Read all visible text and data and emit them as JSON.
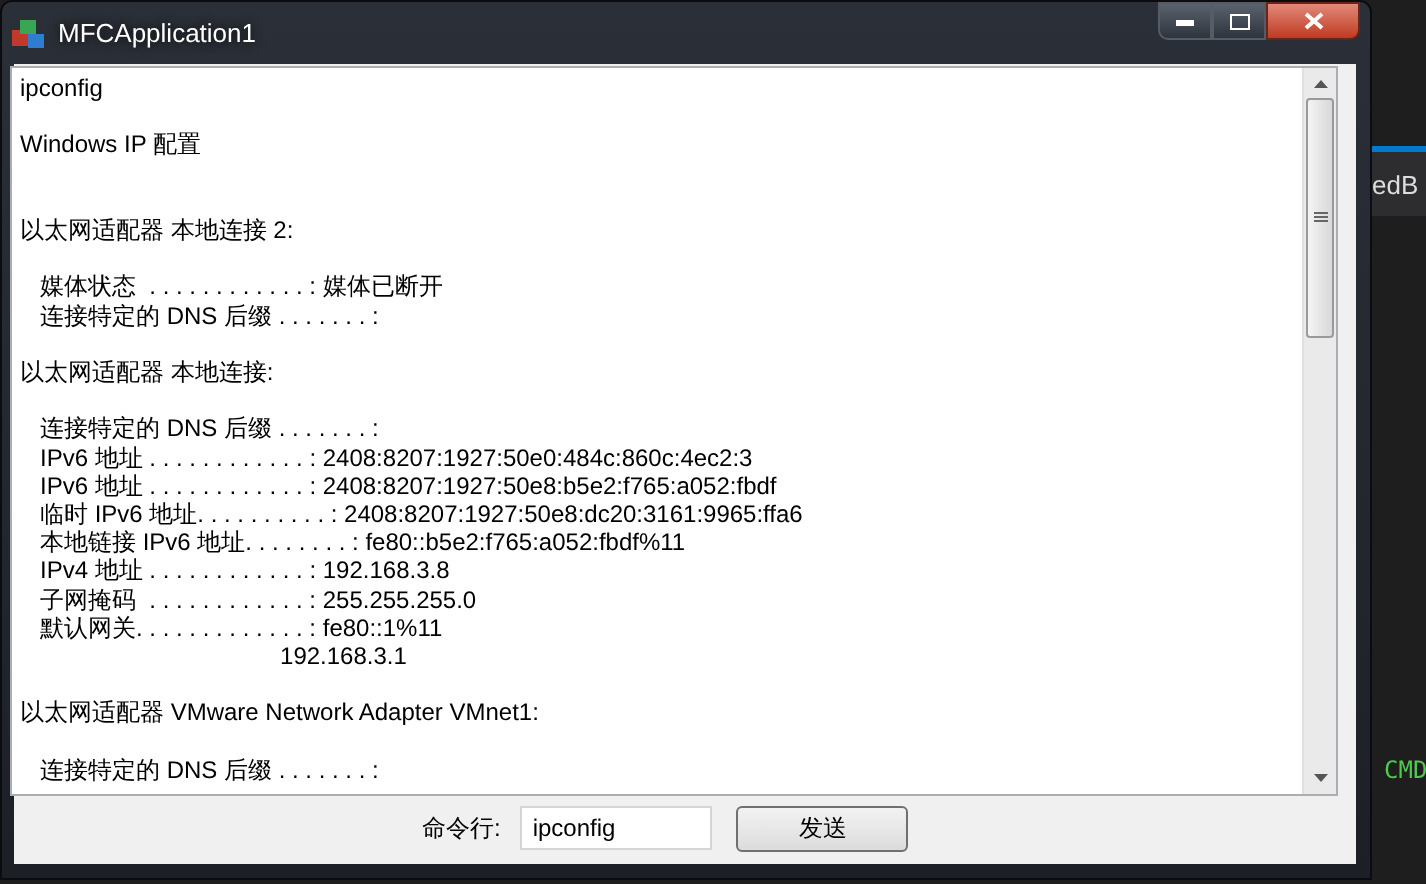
{
  "window": {
    "title": "MFCApplication1"
  },
  "output": [
    {
      "kind": "section",
      "lines": [
        "ipconfig"
      ]
    },
    {
      "kind": "heading",
      "lines": [
        "Windows IP 配置"
      ]
    },
    {
      "kind": "section",
      "lines": [
        "以太网适配器 本地连接 2:"
      ]
    },
    {
      "kind": "section",
      "lines": [
        "   媒体状态  . . . . . . . . . . . . : 媒体已断开",
        "   连接特定的 DNS 后缀 . . . . . . . :"
      ]
    },
    {
      "kind": "section",
      "lines": [
        "以太网适配器 本地连接:"
      ]
    },
    {
      "kind": "section",
      "lines": [
        "   连接特定的 DNS 后缀 . . . . . . . :",
        "   IPv6 地址 . . . . . . . . . . . . : 2408:8207:1927:50e0:484c:860c:4ec2:3",
        "   IPv6 地址 . . . . . . . . . . . . : 2408:8207:1927:50e8:b5e2:f765:a052:fbdf",
        "   临时 IPv6 地址. . . . . . . . . . : 2408:8207:1927:50e8:dc20:3161:9965:ffa6",
        "   本地链接 IPv6 地址. . . . . . . . : fe80::b5e2:f765:a052:fbdf%11",
        "   IPv4 地址 . . . . . . . . . . . . : 192.168.3.8",
        "   子网掩码  . . . . . . . . . . . . : 255.255.255.0",
        "   默认网关. . . . . . . . . . . . . : fe80::1%11",
        "                                       192.168.3.1"
      ]
    },
    {
      "kind": "section",
      "lines": [
        "以太网适配器 VMware Network Adapter VMnet1:"
      ]
    },
    {
      "kind": "section",
      "lines": [
        "   连接特定的 DNS 后缀 . . . . . . . :"
      ]
    }
  ],
  "command": {
    "label": "命令行:",
    "value": "ipconfig"
  },
  "send_button": "发送",
  "background_texts": [
    "edB",
    "CMD"
  ]
}
